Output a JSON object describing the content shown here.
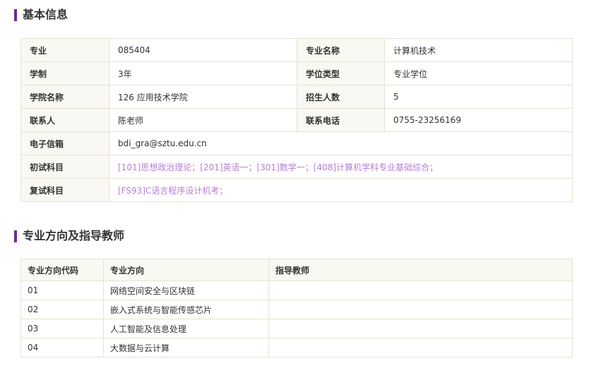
{
  "basic_info": {
    "title": "基本信息",
    "rows": [
      {
        "label1": "专业",
        "value1": "085404",
        "label2": "专业名称",
        "value2": "计算机技术"
      },
      {
        "label1": "学制",
        "value1": "3年",
        "label2": "学位类型",
        "value2": "专业学位"
      },
      {
        "label1": "学院名称",
        "value1": "126 应用技术学院",
        "label2": "招生人数",
        "value2": "5"
      },
      {
        "label1": "联系人",
        "value1": "陈老师",
        "label2": "联系电话",
        "value2": "0755-23256169"
      }
    ],
    "email": {
      "label": "电子信箱",
      "value": "bdi_gra@sztu.edu.cn"
    },
    "prelim_subjects": {
      "label": "初试科目",
      "value": "[101]思想政治理论；[201]英语一；[301]数学一；[408]计算机学科专业基础综合；"
    },
    "retest_subjects": {
      "label": "复试科目",
      "value": "[FS93]C语言程序设计机考；"
    }
  },
  "directions": {
    "title": "专业方向及指导教师",
    "headers": {
      "code": "专业方向代码",
      "name": "专业方向",
      "advisor": "指导教师"
    },
    "rows": [
      {
        "code": "01",
        "name": "网络空间安全与区块链",
        "advisor": ""
      },
      {
        "code": "02",
        "name": "嵌入式系统与智能传感芯片",
        "advisor": ""
      },
      {
        "code": "03",
        "name": "人工智能及信息处理",
        "advisor": ""
      },
      {
        "code": "04",
        "name": "大数据与云计算",
        "advisor": ""
      }
    ]
  },
  "colors": {
    "accent": "#6d2b88",
    "link": "#b67fd2",
    "border": "#e8e2d2",
    "label_bg": "#faf8f3"
  }
}
